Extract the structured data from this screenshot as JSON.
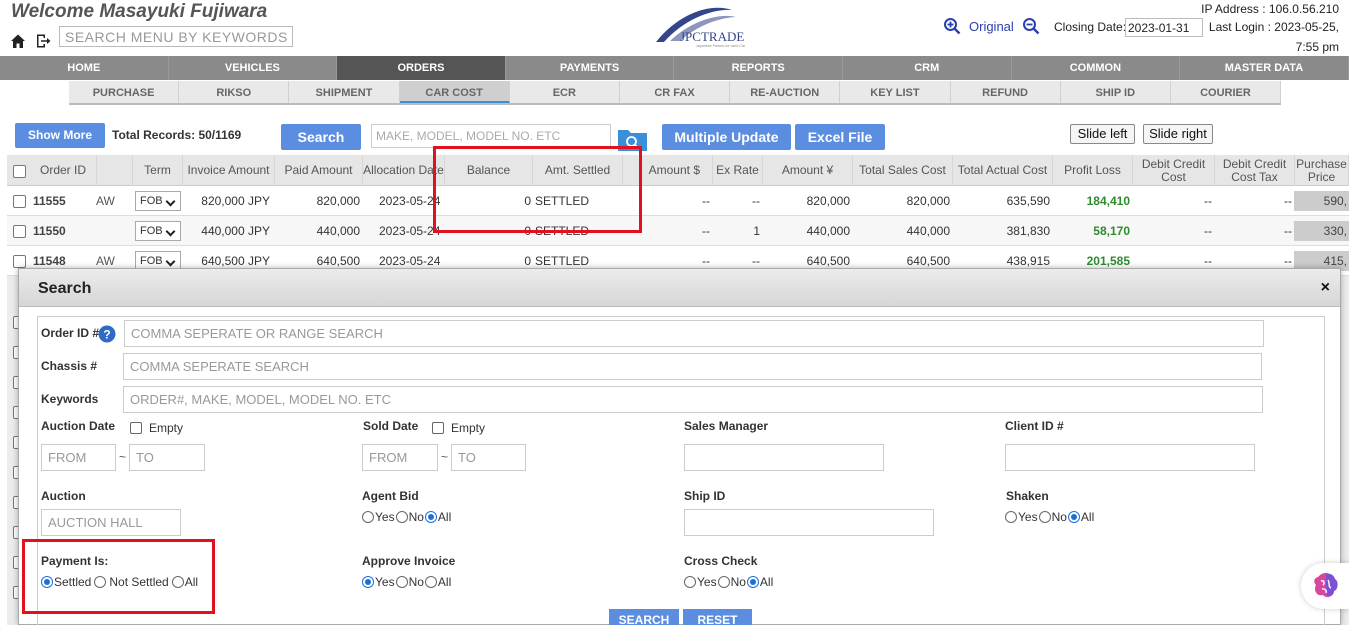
{
  "header": {
    "welcome": "Welcome Masayuki Fujiwara",
    "menu_search_placeholder": "SEARCH MENU BY KEYWORDS..",
    "logo_text": "JPCTRADE",
    "logo_tagline": "Japanese Partner for used Car",
    "zoom_label": "Original",
    "closing_label": "Closing Date:",
    "closing_value": "2023-01-31",
    "ip": "IP Address : 106.0.56.210",
    "last_login": "Last Login : 2023-05-25,",
    "last_login_time": "7:55 pm"
  },
  "main_nav": [
    "HOME",
    "VEHICLES",
    "ORDERS",
    "PAYMENTS",
    "REPORTS",
    "CRM",
    "COMMON",
    "MASTER DATA"
  ],
  "main_nav_active": "ORDERS",
  "sub_nav": [
    "PURCHASE",
    "RIKSO",
    "SHIPMENT",
    "CAR COST",
    "ECR",
    "CR FAX",
    "RE-AUCTION",
    "KEY LIST",
    "REFUND",
    "SHIP ID",
    "COURIER"
  ],
  "sub_nav_active": "CAR COST",
  "toolbar": {
    "show_more": "Show More",
    "total": "Total Records: 50/1169",
    "search": "Search",
    "make_placeholder": "MAKE, MODEL, MODEL NO. ETC",
    "multiple_update": "Multiple Update",
    "excel_file": "Excel File",
    "slide_left": "Slide left",
    "slide_right": "Slide right"
  },
  "table": {
    "headers": [
      "Order ID",
      "Term",
      "Invoice Amount",
      "Paid Amount",
      "Allocation Date",
      "Balance",
      "Amt. Settled",
      "Amount $",
      "Ex Rate",
      "Amount ¥",
      "Total Sales Cost",
      "Total Actual Cost",
      "Profit Loss",
      "Debit Credit Cost",
      "Debit Credit Cost Tax",
      "Purchase Price"
    ],
    "rows": [
      {
        "id": "11555",
        "aw": "AW",
        "term": "FOB",
        "invoice": "820,000 JPY",
        "paid": "820,000",
        "date": "2023-05-24",
        "balance": "0",
        "settled": "SETTLED",
        "amount_usd": "--",
        "ex_rate": "--",
        "amount_jpy": "820,000",
        "sales_cost": "820,000",
        "actual_cost": "635,590",
        "profit": "184,410",
        "dc_cost": "--",
        "dc_tax": "--",
        "purchase": "590,"
      },
      {
        "id": "11550",
        "aw": "",
        "term": "FOB",
        "invoice": "440,000 JPY",
        "paid": "440,000",
        "date": "2023-05-24",
        "balance": "0",
        "settled": "SETTLED",
        "amount_usd": "--",
        "ex_rate": "1",
        "amount_jpy": "440,000",
        "sales_cost": "440,000",
        "actual_cost": "381,830",
        "profit": "58,170",
        "dc_cost": "--",
        "dc_tax": "--",
        "purchase": "330,"
      },
      {
        "id": "11548",
        "aw": "AW",
        "term": "FOB",
        "invoice": "640,500 JPY",
        "paid": "640,500",
        "date": "2023-05-24",
        "balance": "0",
        "settled": "SETTLED",
        "amount_usd": "--",
        "ex_rate": "--",
        "amount_jpy": "640,500",
        "sales_cost": "640,500",
        "actual_cost": "438,915",
        "profit": "201,585",
        "dc_cost": "--",
        "dc_tax": "--",
        "purchase": "415,"
      }
    ]
  },
  "modal": {
    "title": "Search",
    "close": "×",
    "order_id_label": "Order ID #",
    "order_id_placeholder": "COMMA SEPERATE OR RANGE SEARCH",
    "chassis_label": "Chassis #",
    "chassis_placeholder": "COMMA SEPERATE SEARCH",
    "keywords_label": "Keywords",
    "keywords_placeholder": "ORDER#, MAKE, MODEL, MODEL NO. ETC",
    "auction_date_label": "Auction Date",
    "sold_date_label": "Sold Date",
    "empty_label": "Empty",
    "from_placeholder": "FROM",
    "to_placeholder": "TO",
    "tilde": "~",
    "sales_manager_label": "Sales Manager",
    "client_id_label": "Client ID #",
    "auction_label": "Auction",
    "auction_placeholder": "AUCTION HALL",
    "agent_bid_label": "Agent Bid",
    "ship_id_label": "Ship ID",
    "shaken_label": "Shaken",
    "payment_label": "Payment Is:",
    "approve_invoice_label": "Approve Invoice",
    "cross_check_label": "Cross Check",
    "yes": "Yes",
    "no": "No",
    "all": "All",
    "settled": "Settled",
    "not_settled": "Not Settled",
    "search_btn": "SEARCH",
    "reset_btn": "RESET"
  }
}
